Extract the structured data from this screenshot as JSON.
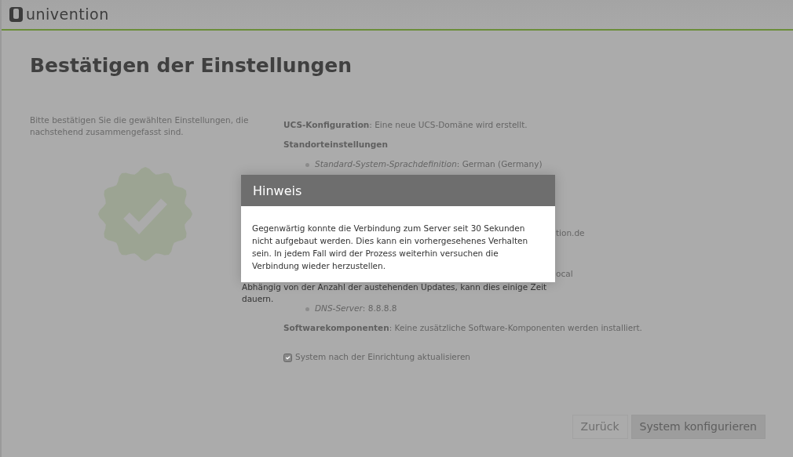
{
  "header": {
    "logo_text": "univention"
  },
  "page": {
    "title": "Bestätigen der Einstellungen",
    "intro": "Bitte bestätigen Sie die gewählten Einstellungen, die nachstehend zusammengefasst sind.",
    "summary": [
      {
        "kind": "line",
        "label": "UCS-Konfiguration",
        "text": ": Eine neue UCS-Domäne wird erstellt."
      },
      {
        "kind": "heading",
        "label": "Standorteinstellungen"
      },
      {
        "kind": "bullet",
        "label": "Standard-System-Sprachdefinition",
        "text": ": German (Germany)"
      },
      {
        "kind": "fragment",
        "text": "tion.de"
      },
      {
        "kind": "fragment",
        "text": "ocal"
      },
      {
        "kind": "bullet",
        "label": "DNS-Server",
        "text": ": 8.8.8.8"
      },
      {
        "kind": "line",
        "label": "Softwarekomponenten",
        "text": ": Keine zusätzliche Software-Komponenten werden installiert."
      }
    ],
    "update_checkbox": {
      "label": "System nach der Einrichtung aktualisieren",
      "checked": true
    },
    "buttons": [
      {
        "label": "Zurück",
        "kind": "secondary"
      },
      {
        "label": "System konfigurieren",
        "kind": "primary"
      }
    ]
  },
  "progress_text": "Abhängig von der Anzahl der austehenden Updates, kann dies einige Zeit dauern.",
  "dialog": {
    "title": "Hinweis",
    "message": "Gegenwärtig konnte die Verbindung zum Server seit 30 Sekunden nicht aufgebaut werden. Dies kann ein vorhergesehenes Verhalten sein. In jedem Fall wird der Prozess weiterhin versuchen die Verbindung wieder herzustellen."
  }
}
